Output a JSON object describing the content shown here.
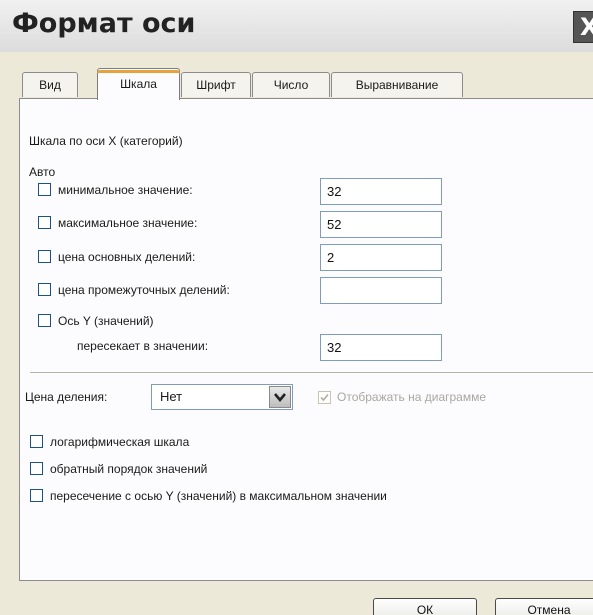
{
  "window": {
    "title": "Формат оси",
    "close_glyph": "X"
  },
  "tabs": [
    {
      "label": "Вид",
      "active": false
    },
    {
      "label": "Шкала",
      "active": true
    },
    {
      "label": "Шрифт",
      "active": false
    },
    {
      "label": "Число",
      "active": false
    },
    {
      "label": "Выравнивание",
      "active": false
    }
  ],
  "scale": {
    "heading": "Шкала по оси X (категорий)",
    "auto_label": "Авто",
    "min_label": "минимальное значение:",
    "min_value": "32",
    "max_label": "максимальное значение:",
    "max_value": "52",
    "major_label": "цена основных делений:",
    "major_value": "2",
    "minor_label": "цена промежуточных делений:",
    "minor_value": "",
    "yaxis_label": "Ось Y (значений)",
    "crosses_label": "пересекает в значении:",
    "crosses_value": "32"
  },
  "display_units": {
    "label": "Цена деления:",
    "selected": "Нет",
    "show_on_chart_label": "Отображать на диаграмме",
    "show_on_chart_checked": true
  },
  "options": {
    "log_label": "логарифмическая шкала",
    "reverse_label": "обратный порядок значений",
    "cross_max_label": "пересечение с осью Y (значений) в максимальном значении"
  },
  "buttons": {
    "ok_label": "ОК",
    "cancel_label": "Отмена"
  },
  "colors": {
    "accent_tab": "#e6a23c",
    "checkbox_border": "#1c5180",
    "input_border": "#7f9db9"
  }
}
